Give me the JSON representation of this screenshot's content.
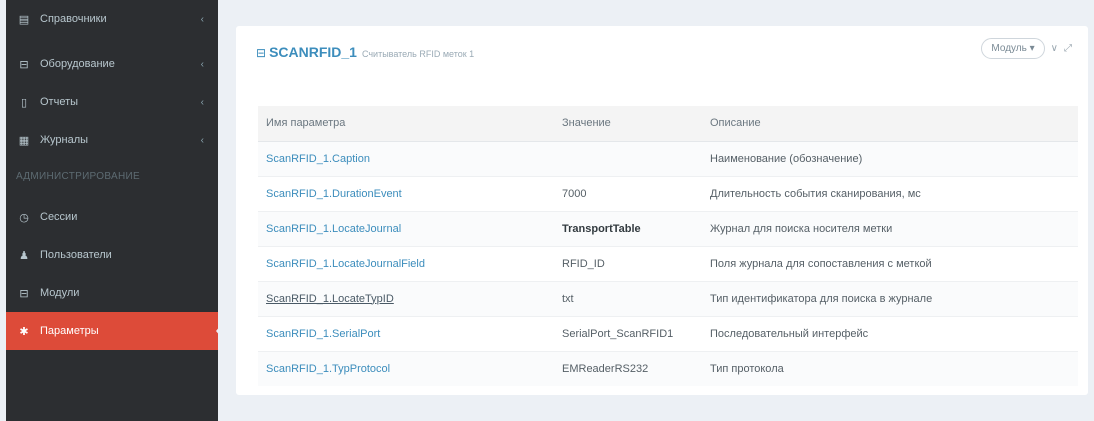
{
  "sidebar": {
    "items_top": [
      {
        "label": "Справочники",
        "icon": "book-icon",
        "glyph": "▤",
        "chevron": "‹"
      },
      {
        "label": "Оборудование",
        "icon": "cube-icon",
        "glyph": "⊟",
        "chevron": "‹"
      },
      {
        "label": "Отчеты",
        "icon": "file-icon",
        "glyph": "▯",
        "chevron": "‹"
      },
      {
        "label": "Журналы",
        "icon": "grid-icon",
        "glyph": "▦",
        "chevron": "‹"
      }
    ],
    "section_header": "АДМИНИСТРИРОВАНИЕ",
    "items_admin": [
      {
        "label": "Сессии",
        "icon": "clock-icon",
        "glyph": "◷"
      },
      {
        "label": "Пользователи",
        "icon": "user-icon",
        "glyph": "♟"
      },
      {
        "label": "Модули",
        "icon": "module-icon",
        "glyph": "⊟"
      },
      {
        "label": "Параметры",
        "icon": "gear-icon",
        "glyph": "✱",
        "active": true
      }
    ],
    "active_color": "#dd4b39"
  },
  "box": {
    "title": "SCANRFID_1",
    "subtitle": "Считыватель RFID меток 1",
    "title_icon": "⊟",
    "module_button": "Модуль",
    "module_caret": "▾",
    "collapse_glyph": "∨",
    "expand_glyph": "⤢"
  },
  "table": {
    "headers": [
      "Имя параметра",
      "Значение",
      "Описание"
    ],
    "rows": [
      {
        "name": "ScanRFID_1.Caption",
        "value": "",
        "desc": "Наименование (обозначение)"
      },
      {
        "name": "ScanRFID_1.DurationEvent",
        "value": "7000",
        "desc": "Длительность события сканирования, мс"
      },
      {
        "name": "ScanRFID_1.LocateJournal",
        "value": "TransportTable",
        "desc": "Журнал для поиска носителя метки",
        "bold": true
      },
      {
        "name": "ScanRFID_1.LocateJournalField",
        "value": "RFID_ID",
        "desc": "Поля журнала для сопоставления с меткой"
      },
      {
        "name": "ScanRFID_1.LocateTypID",
        "value": "txt",
        "desc": "Тип идентификатора для поиска в журнале",
        "underline": true
      },
      {
        "name": "ScanRFID_1.SerialPort",
        "value": "SerialPort_ScanRFID1",
        "desc": "Последовательный интерфейс"
      },
      {
        "name": "ScanRFID_1.TypProtocol",
        "value": "EMReaderRS232",
        "desc": "Тип протокола"
      }
    ]
  },
  "colors": {
    "accent": "#3c8dbc",
    "sidebar_bg": "#2c2e31",
    "page_bg": "#ecf0f5"
  }
}
